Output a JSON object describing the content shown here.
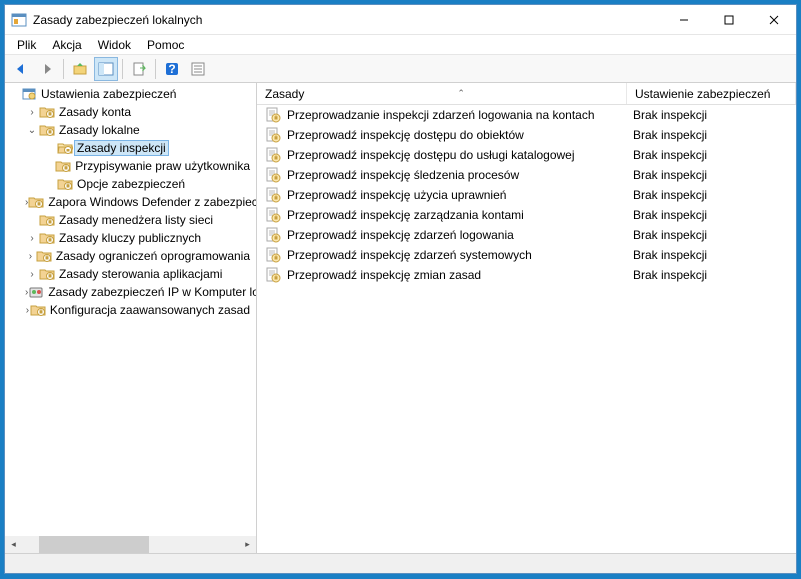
{
  "window": {
    "title": "Zasady zabezpieczeń lokalnych"
  },
  "menubar": [
    "Plik",
    "Akcja",
    "Widok",
    "Pomoc"
  ],
  "tree": {
    "root": "Ustawienia zabezpieczeń",
    "items": [
      {
        "label": "Zasady konta",
        "indent": 1,
        "expander": "›",
        "icon": "folder"
      },
      {
        "label": "Zasady lokalne",
        "indent": 1,
        "expander": "⌄",
        "icon": "folder"
      },
      {
        "label": "Zasady inspekcji",
        "indent": 2,
        "expander": "",
        "icon": "folder",
        "selected": true
      },
      {
        "label": "Przypisywanie praw użytkownika",
        "indent": 2,
        "expander": "",
        "icon": "folder"
      },
      {
        "label": "Opcje zabezpieczeń",
        "indent": 2,
        "expander": "",
        "icon": "folder"
      },
      {
        "label": "Zapora Windows Defender z zabezpieczeniami",
        "indent": 1,
        "expander": "›",
        "icon": "folder"
      },
      {
        "label": "Zasady menedżera listy sieci",
        "indent": 1,
        "expander": "",
        "icon": "folder-net"
      },
      {
        "label": "Zasady kluczy publicznych",
        "indent": 1,
        "expander": "›",
        "icon": "folder"
      },
      {
        "label": "Zasady ograniczeń oprogramowania",
        "indent": 1,
        "expander": "›",
        "icon": "folder"
      },
      {
        "label": "Zasady sterowania aplikacjami",
        "indent": 1,
        "expander": "›",
        "icon": "folder"
      },
      {
        "label": "Zasady zabezpieczeń IP w Komputer lokalny",
        "indent": 1,
        "expander": "›",
        "icon": "ip"
      },
      {
        "label": "Konfiguracja zaawansowanych zasad",
        "indent": 1,
        "expander": "›",
        "icon": "folder"
      }
    ]
  },
  "list": {
    "columns": {
      "name": "Zasady",
      "setting": "Ustawienie zabezpieczeń"
    },
    "rows": [
      {
        "name": "Przeprowadzanie inspekcji zdarzeń logowania na kontach",
        "setting": "Brak inspekcji"
      },
      {
        "name": "Przeprowadź inspekcję dostępu do obiektów",
        "setting": "Brak inspekcji"
      },
      {
        "name": "Przeprowadź inspekcję dostępu do usługi katalogowej",
        "setting": "Brak inspekcji"
      },
      {
        "name": "Przeprowadź inspekcję śledzenia procesów",
        "setting": "Brak inspekcji"
      },
      {
        "name": "Przeprowadź inspekcję użycia uprawnień",
        "setting": "Brak inspekcji"
      },
      {
        "name": "Przeprowadź inspekcję zarządzania kontami",
        "setting": "Brak inspekcji"
      },
      {
        "name": "Przeprowadź inspekcję zdarzeń logowania",
        "setting": "Brak inspekcji"
      },
      {
        "name": "Przeprowadź inspekcję zdarzeń systemowych",
        "setting": "Brak inspekcji"
      },
      {
        "name": "Przeprowadź inspekcję zmian zasad",
        "setting": "Brak inspekcji"
      }
    ]
  }
}
